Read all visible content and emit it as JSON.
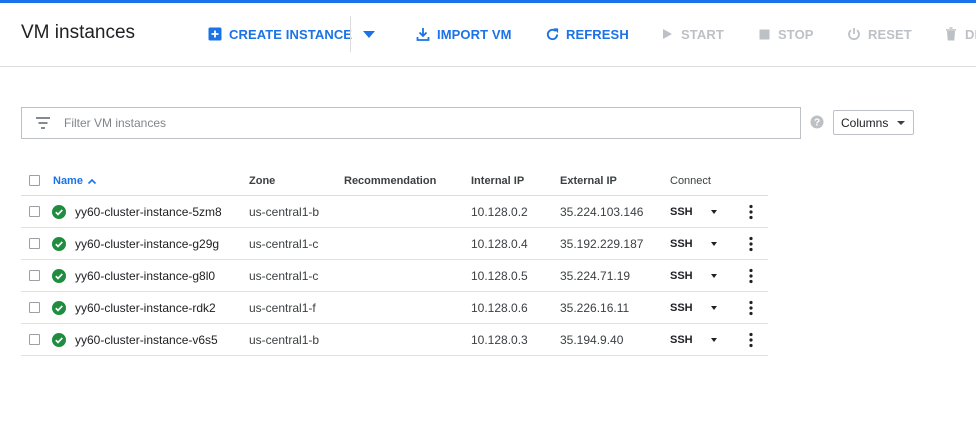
{
  "page": {
    "title": "VM instances"
  },
  "colors": {
    "accent": "#1a73e8",
    "disabled": "#bdc1c6",
    "status_ok": "#1e8e3e"
  },
  "toolbar": {
    "create_label": "CREATE INSTANCE",
    "create_icon": "add-box-icon",
    "import_label": "IMPORT VM",
    "import_icon": "download-icon",
    "refresh_label": "REFRESH",
    "refresh_icon": "refresh-icon",
    "start_label": "START",
    "start_icon": "play-icon",
    "stop_label": "STOP",
    "stop_icon": "stop-icon",
    "reset_label": "RESET",
    "reset_icon": "power-icon",
    "delete_label": "DE",
    "delete_icon": "trash-icon"
  },
  "filter": {
    "placeholder": "Filter VM instances"
  },
  "columns_button": {
    "label": "Columns"
  },
  "table": {
    "headers": {
      "name": "Name",
      "zone": "Zone",
      "recommendation": "Recommendation",
      "internal_ip": "Internal IP",
      "external_ip": "External IP",
      "connect": "Connect"
    },
    "sort": {
      "column": "Name",
      "direction": "ascending"
    },
    "rows": [
      {
        "name": "yy60-cluster-instance-5zm8",
        "zone": "us-central1-b",
        "recommendation": "",
        "internal_ip": "10.128.0.2",
        "external_ip": "35.224.103.146",
        "connect": "SSH",
        "status": "running"
      },
      {
        "name": "yy60-cluster-instance-g29g",
        "zone": "us-central1-c",
        "recommendation": "",
        "internal_ip": "10.128.0.4",
        "external_ip": "35.192.229.187",
        "connect": "SSH",
        "status": "running"
      },
      {
        "name": "yy60-cluster-instance-g8l0",
        "zone": "us-central1-c",
        "recommendation": "",
        "internal_ip": "10.128.0.5",
        "external_ip": "35.224.71.19",
        "connect": "SSH",
        "status": "running"
      },
      {
        "name": "yy60-cluster-instance-rdk2",
        "zone": "us-central1-f",
        "recommendation": "",
        "internal_ip": "10.128.0.6",
        "external_ip": "35.226.16.11",
        "connect": "SSH",
        "status": "running"
      },
      {
        "name": "yy60-cluster-instance-v6s5",
        "zone": "us-central1-b",
        "recommendation": "",
        "internal_ip": "10.128.0.3",
        "external_ip": "35.194.9.40",
        "connect": "SSH",
        "status": "running"
      }
    ]
  }
}
